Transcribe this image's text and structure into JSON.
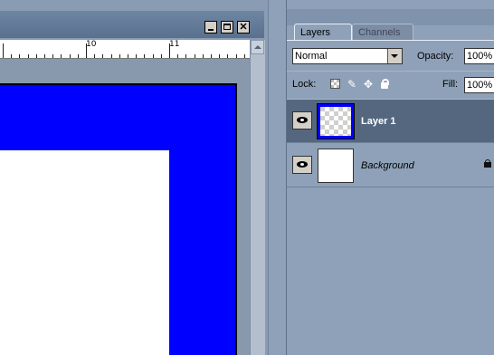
{
  "document_window": {
    "controls": {
      "minimize": "minimize",
      "maximize": "maximize",
      "close": "✕"
    },
    "ruler": {
      "labels": [
        "10",
        "11"
      ]
    },
    "canvas": {
      "layer_color": "#0000ff",
      "background_color": "#ffffff"
    }
  },
  "layers_panel": {
    "tabs": [
      {
        "label": "Layers",
        "active": true
      },
      {
        "label": "Channels",
        "active": false
      }
    ],
    "blend_mode": "Normal",
    "opacity_label": "Opacity:",
    "opacity_value": "100%",
    "lock_label": "Lock:",
    "lock_icons": [
      "lock-transparent-pixels-icon",
      "lock-image-pixels-icon",
      "lock-position-icon",
      "lock-all-icon"
    ],
    "fill_label": "Fill:",
    "fill_value": "100%",
    "layers": [
      {
        "name": "Layer 1",
        "selected": true,
        "visible": true,
        "thumbnail": "transparent-with-blue-border"
      },
      {
        "name": "Background",
        "selected": false,
        "visible": true,
        "locked": true,
        "thumbnail": "white"
      }
    ]
  }
}
